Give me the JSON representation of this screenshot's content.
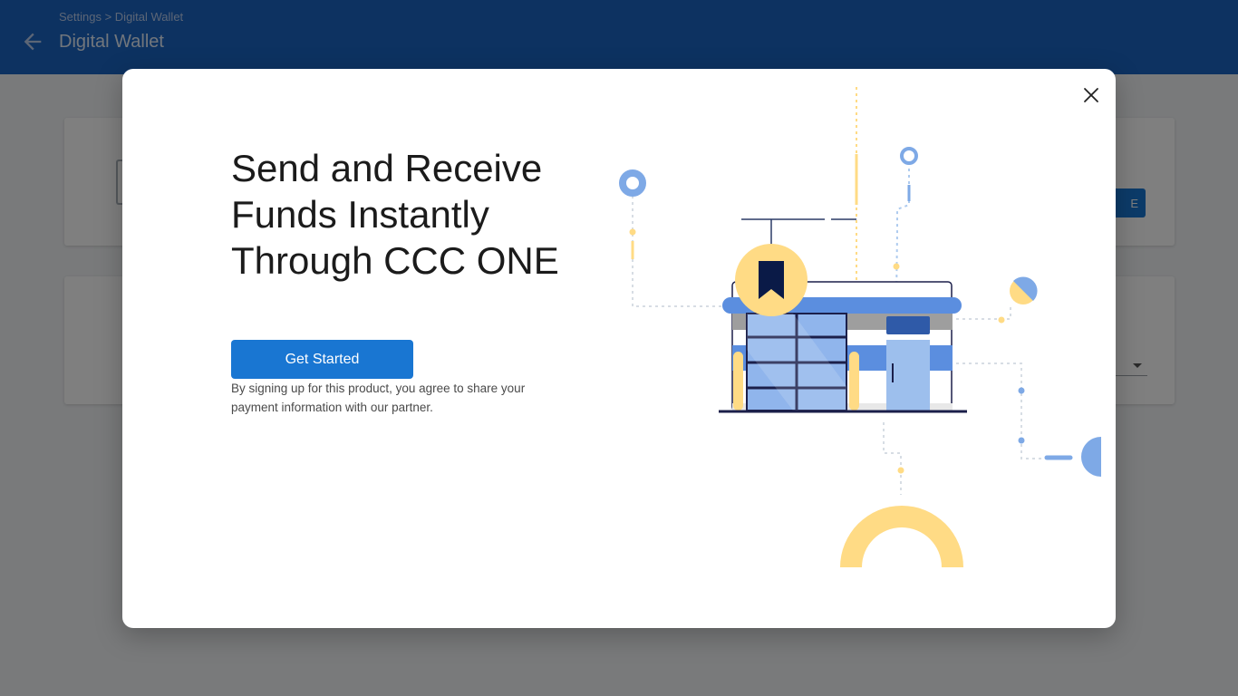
{
  "header": {
    "breadcrumb": "Settings > Digital Wallet",
    "title": "Digital Wallet",
    "back_icon": "arrow-left-icon"
  },
  "background_cards": {
    "card1_button_label": "E"
  },
  "modal": {
    "headline": "Send and Receive Funds Instantly Through CCC ONE",
    "cta_label": "Get Started",
    "disclaimer": "By signing up for this product, you agree to share your payment information with our partner.",
    "close_icon": "close-icon",
    "illustration": "storefront-network-illustration"
  },
  "colors": {
    "header_bg": "#1a64c3",
    "primary": "#1976d2",
    "accent_yellow": "#ffdb85",
    "accent_blue": "#7ea9e6",
    "navy": "#0a1a47"
  }
}
